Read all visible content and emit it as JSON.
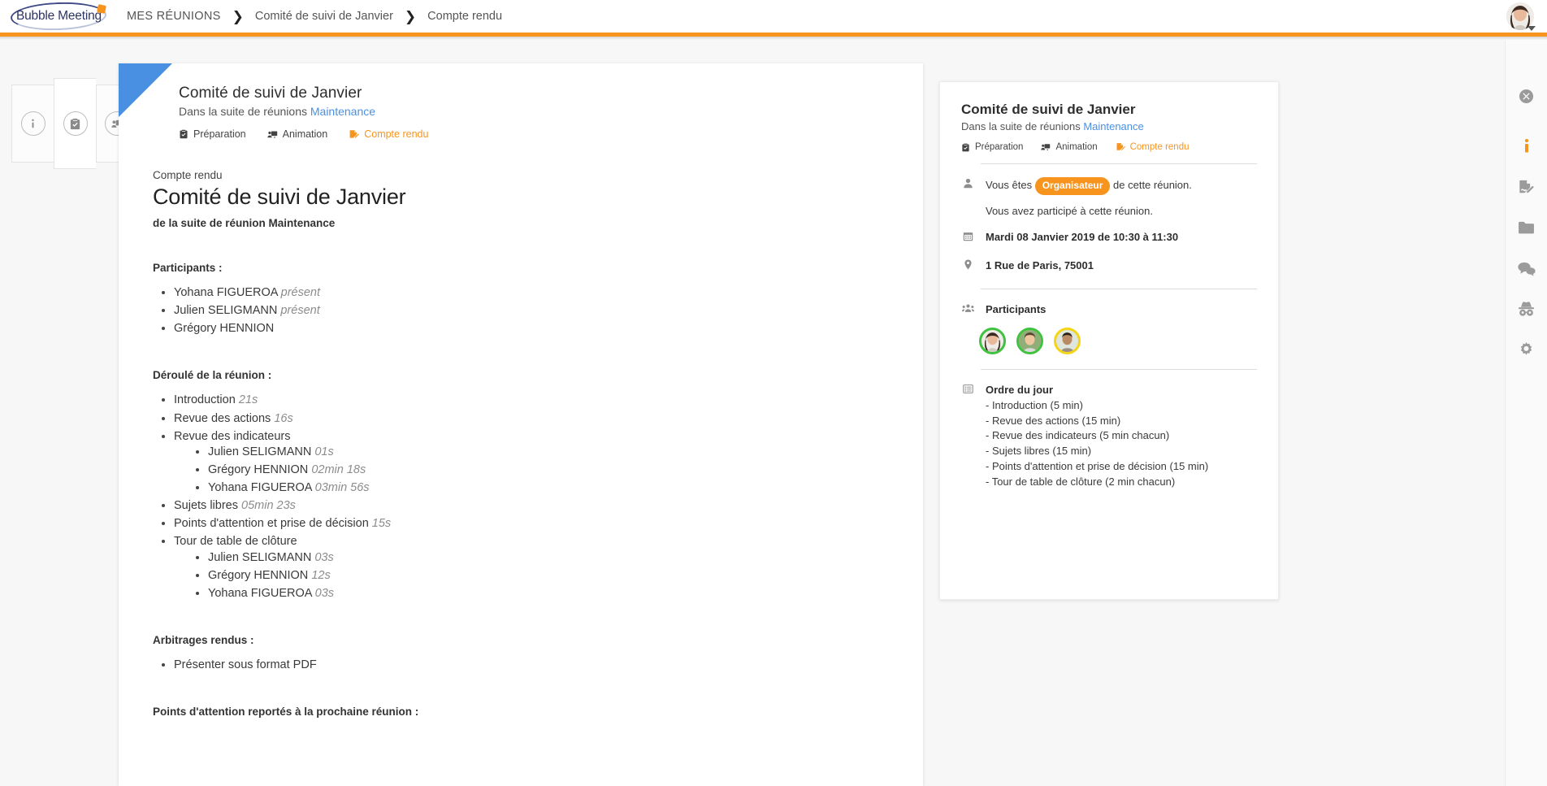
{
  "header": {
    "logo_text": "Bubble Meeting",
    "logo_icon": "bubble-logo",
    "breadcrumb": [
      {
        "label": "MES RÉUNIONS",
        "uppercase": true
      },
      {
        "label": "Comité de suivi de Janvier",
        "uppercase": false
      },
      {
        "label": "Compte rendu",
        "uppercase": false
      }
    ],
    "separator": "❯",
    "accent_color": "#F7941E",
    "user_avatar_name": "user-avatar"
  },
  "left_rail": [
    {
      "icon": "info-icon",
      "name": "sidebar-tab-info"
    },
    {
      "icon": "clipboard-check-icon",
      "name": "sidebar-tab-preparation"
    },
    {
      "icon": "presentation-icon",
      "name": "sidebar-tab-animation"
    }
  ],
  "card": {
    "title": "Comité de suivi de Janvier",
    "subtitle_prefix": "Dans la suite de réunions ",
    "subtitle_link": "Maintenance",
    "tabs": [
      {
        "label": "Préparation",
        "icon": "clipboard-check-icon",
        "active": false
      },
      {
        "label": "Animation",
        "icon": "presentation-icon",
        "active": false
      },
      {
        "label": "Compte rendu",
        "icon": "report-edit-icon",
        "active": true
      }
    ]
  },
  "document": {
    "kicker": "Compte rendu",
    "title": "Comité de suivi de Janvier",
    "subtitle": "de la suite de réunion Maintenance",
    "participants_title": "Participants :",
    "participants": [
      {
        "name": "Yohana FIGUEROA",
        "status": "présent"
      },
      {
        "name": "Julien SELIGMANN",
        "status": "présent"
      },
      {
        "name": "Grégory HENNION",
        "status": ""
      }
    ],
    "agenda_title": "Déroulé de la réunion :",
    "agenda": [
      {
        "label": "Introduction",
        "duration": "21s",
        "children": []
      },
      {
        "label": "Revue des actions",
        "duration": "16s",
        "children": []
      },
      {
        "label": "Revue des indicateurs",
        "duration": "",
        "children": [
          {
            "label": "Julien SELIGMANN",
            "duration": "01s"
          },
          {
            "label": "Grégory HENNION",
            "duration": "02min 18s"
          },
          {
            "label": "Yohana FIGUEROA",
            "duration": "03min 56s"
          }
        ]
      },
      {
        "label": "Sujets libres",
        "duration": "05min 23s",
        "children": []
      },
      {
        "label": "Points d'attention et prise de décision",
        "duration": "15s",
        "children": []
      },
      {
        "label": "Tour de table de clôture",
        "duration": "",
        "children": [
          {
            "label": "Julien SELIGMANN",
            "duration": "03s"
          },
          {
            "label": "Grégory HENNION",
            "duration": "12s"
          },
          {
            "label": "Yohana FIGUEROA",
            "duration": "03s"
          }
        ]
      }
    ],
    "arbitrages_title": "Arbitrages rendus :",
    "arbitrages": [
      "Présenter sous format PDF"
    ],
    "points_title": "Points d'attention reportés à la prochaine réunion :"
  },
  "right_panel": {
    "title": "Comité de suivi de Janvier",
    "subtitle_prefix": "Dans la suite de réunions ",
    "subtitle_link": "Maintenance",
    "tabs": [
      {
        "label": "Préparation",
        "icon": "clipboard-check-icon",
        "active": false
      },
      {
        "label": "Animation",
        "icon": "presentation-icon",
        "active": false
      },
      {
        "label": "Compte rendu",
        "icon": "report-edit-icon",
        "active": true
      }
    ],
    "role_prefix": "Vous êtes ",
    "role_badge": "Organisateur",
    "role_suffix": " de cette réunion.",
    "participation_note": "Vous avez participé à cette réunion.",
    "date_line": "Mardi 08 Janvier 2019 de 10:30 à 11:30",
    "location_line": "1 Rue de Paris, 75001",
    "participants_label": "Participants",
    "participants_avatars": [
      {
        "name": "Yohana FIGUEROA",
        "ring": "#3FC33F"
      },
      {
        "name": "Julien SELIGMANN",
        "ring": "#3FC33F"
      },
      {
        "name": "Grégory HENNION",
        "ring": "#F5D516"
      }
    ],
    "agenda_label": "Ordre du jour",
    "agenda_lines": [
      "- Introduction (5 min)",
      "- Revue des actions (15 min)",
      "- Revue des indicateurs (5 min chacun)",
      "- Sujets libres (15 min)",
      "- Points d'attention et prise de décision (15 min)",
      "- Tour de table de clôture (2 min chacun)"
    ]
  },
  "far_rail": [
    {
      "icon": "close-icon",
      "name": "close-panel-button",
      "active": false
    },
    {
      "icon": "info-icon",
      "name": "rail-info-button",
      "active": true
    },
    {
      "icon": "report-edit-icon",
      "name": "rail-report-button",
      "active": false
    },
    {
      "icon": "folder-icon",
      "name": "rail-documents-button",
      "active": false
    },
    {
      "icon": "chat-icon",
      "name": "rail-chat-button",
      "active": false
    },
    {
      "icon": "spy-icon",
      "name": "rail-anonymous-button",
      "active": false
    },
    {
      "icon": "gear-icon",
      "name": "rail-settings-button",
      "active": false
    }
  ]
}
